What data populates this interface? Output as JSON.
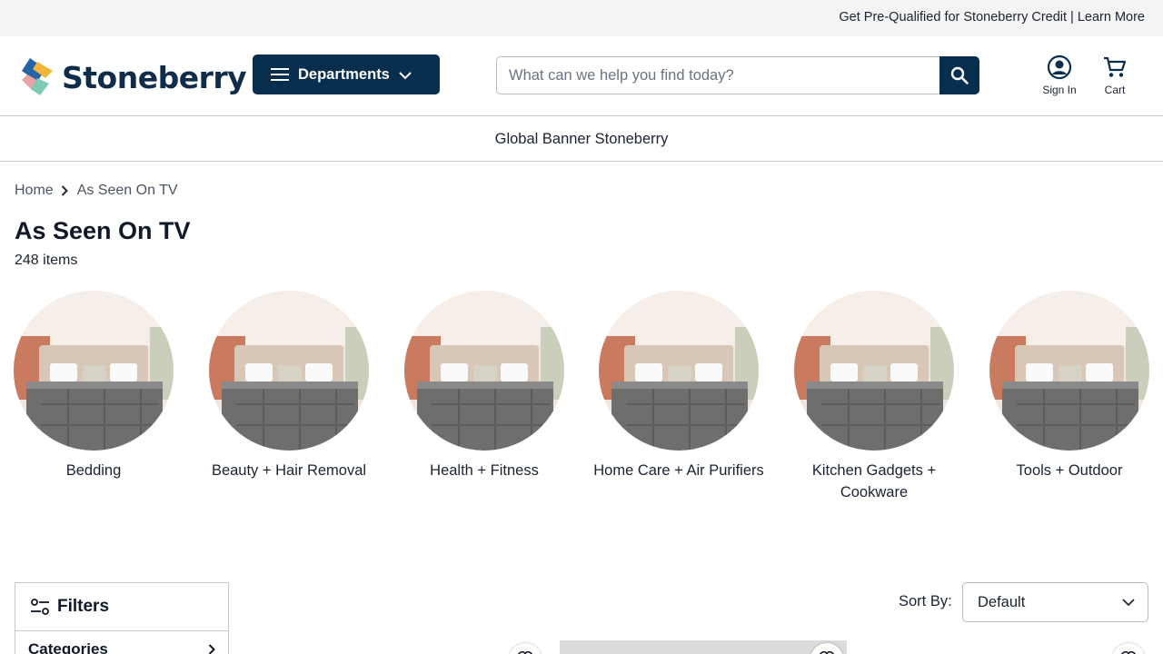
{
  "promo": {
    "text": "Get Pre-Qualified for Stoneberry Credit | Learn More"
  },
  "header": {
    "logo_text": "Stoneberry",
    "departments_label": "Departments",
    "search_placeholder": "What can we help you find today?",
    "sign_in_label": "Sign In",
    "cart_label": "Cart"
  },
  "global_banner": {
    "text": "Global Banner Stoneberry"
  },
  "breadcrumb": {
    "home": "Home",
    "current": "As Seen On TV"
  },
  "page": {
    "title": "As Seen On TV",
    "item_count": "248 items"
  },
  "categories": [
    {
      "label": "Bedding"
    },
    {
      "label": "Beauty + Hair Removal"
    },
    {
      "label": "Health + Fitness"
    },
    {
      "label": "Home Care + Air Purifiers"
    },
    {
      "label": "Kitchen Gadgets + Cookware"
    },
    {
      "label": "Tools + Outdoor"
    }
  ],
  "filters": {
    "title": "Filters",
    "first_section": "Categories"
  },
  "sort": {
    "label": "Sort By:",
    "selected": "Default"
  },
  "colors": {
    "brand_navy": "#082e4e",
    "border": "#c8c8c8",
    "promo_bg": "#f4f4f4"
  }
}
